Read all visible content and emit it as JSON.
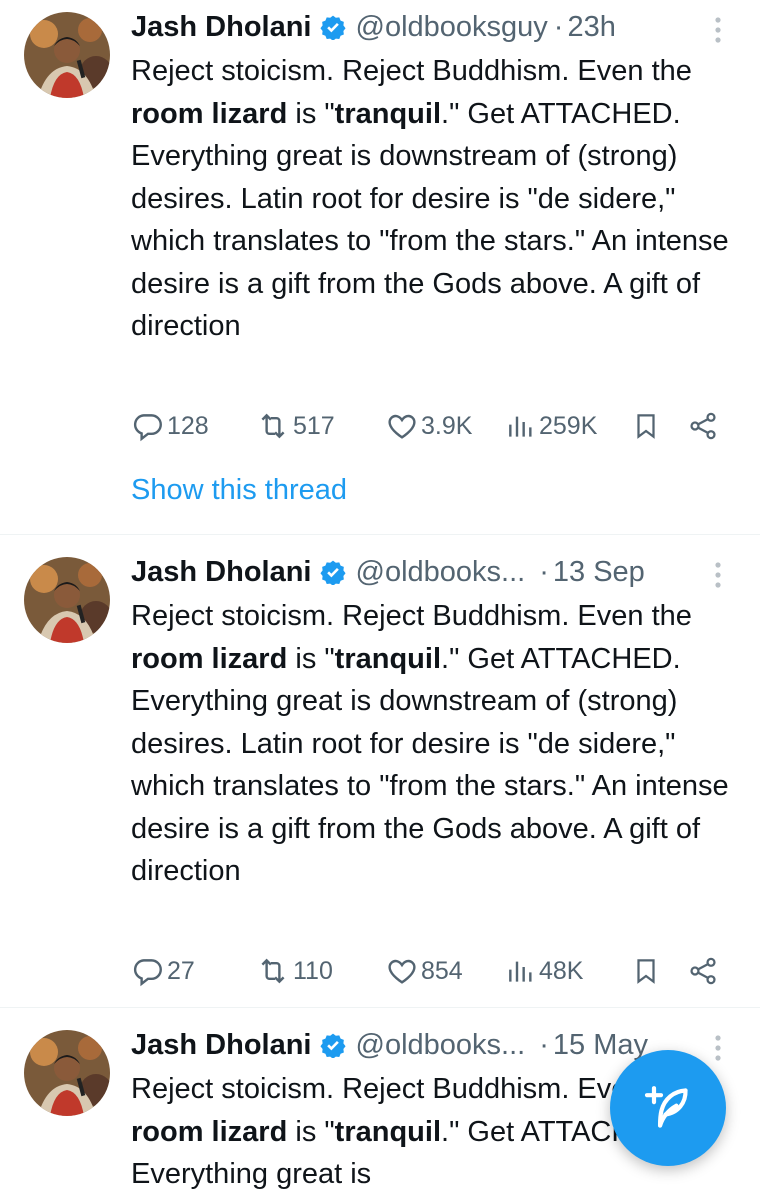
{
  "colors": {
    "accent": "#1d9bf0",
    "muted": "#536471",
    "text": "#0f1419"
  },
  "tweets": [
    {
      "name": "Jash Dholani",
      "handle": "@oldbooksguy",
      "separator": "·",
      "time": "23h",
      "text": {
        "p1": "Reject stoicism. Reject Buddhism. Even the ",
        "b1": "room lizard",
        "p2": " is \"",
        "b2": "tranquil",
        "p3": ".\" Get ATTACHED. Everything great is downstream of (strong) desires. Latin root for desire is \"de sidere,\" which translates to \"from the stars.\" An intense desire is a gift from the Gods above. A gift of direction"
      },
      "replies": "128",
      "reposts": "517",
      "likes": "3.9K",
      "views": "259K",
      "show_thread": "Show this thread"
    },
    {
      "name": "Jash Dholani",
      "handle": "@oldbooks...",
      "separator": "·",
      "time": "13 Sep",
      "text": {
        "p1": "Reject stoicism. Reject Buddhism. Even the ",
        "b1": "room lizard",
        "p2": " is \"",
        "b2": "tranquil",
        "p3": ".\" Get ATTACHED. Everything great is downstream of (strong) desires. Latin root for desire is \"de sidere,\" which translates to \"from the stars.\" An intense desire is a gift from the Gods above. A gift of direction"
      },
      "replies": "27",
      "reposts": "110",
      "likes": "854",
      "views": "48K"
    },
    {
      "name": "Jash Dholani",
      "handle": "@oldbooks...",
      "separator": "·",
      "time": "15 May",
      "text": {
        "p1": "Reject stoicism. Reject Buddhism. Even the ",
        "b1": "room lizard",
        "p2": " is \"",
        "b2": "tranquil",
        "p3": ".\" Get ATTACHED. Everything great is"
      }
    }
  ],
  "icons": {
    "verified": "verified-badge-icon",
    "more": "more-vertical-icon",
    "reply": "reply-icon",
    "repost": "repost-icon",
    "like": "heart-icon",
    "views": "views-icon",
    "bookmark": "bookmark-icon",
    "share": "share-icon",
    "compose": "compose-post-icon"
  }
}
